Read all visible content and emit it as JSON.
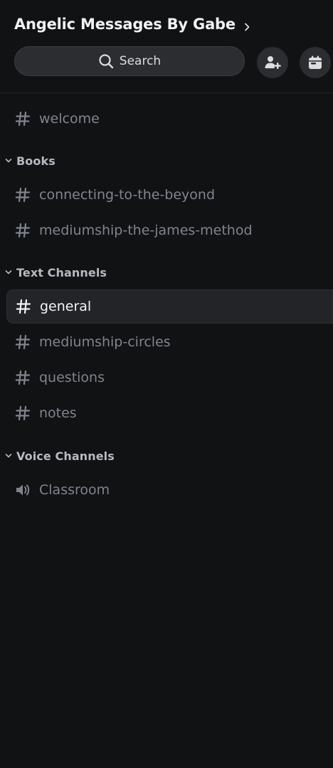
{
  "server": {
    "name": "Angelic Messages By Gabe"
  },
  "search": {
    "label": "Search"
  },
  "icons": {
    "chevron": "chevron-right-icon",
    "search": "search-icon",
    "invite": "add-member-icon",
    "events": "calendar-icon",
    "text_channel": "hash-icon",
    "voice_channel": "speaker-icon",
    "category": "chevron-down-icon"
  },
  "colors": {
    "background": "#111214",
    "surface": "#2b2d31",
    "selected": "#232428",
    "muted_text": "#80848e",
    "bright_text": "#f2f3f5"
  },
  "uncategorized": [
    {
      "name": "welcome",
      "type": "text"
    }
  ],
  "categories": [
    {
      "name": "Books",
      "channels": [
        {
          "name": "connecting-to-the-beyond",
          "type": "text"
        },
        {
          "name": "mediumship-the-james-method",
          "type": "text"
        }
      ]
    },
    {
      "name": "Text Channels",
      "channels": [
        {
          "name": "general",
          "type": "text",
          "selected": true
        },
        {
          "name": "mediumship-circles",
          "type": "text"
        },
        {
          "name": "questions",
          "type": "text"
        },
        {
          "name": "notes",
          "type": "text"
        }
      ]
    },
    {
      "name": "Voice Channels",
      "channels": [
        {
          "name": "Classroom",
          "type": "voice"
        }
      ]
    }
  ]
}
